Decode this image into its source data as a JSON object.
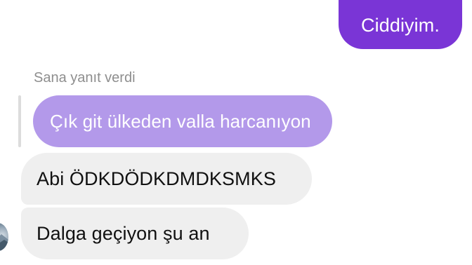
{
  "chat": {
    "sent_message": "Ciddiyim.",
    "reply_label": "Sana yanıt verdi",
    "quoted_message": "Çık git ülkeden valla harcanıyon",
    "received_messages": [
      "Abi ÖDKDÖDKDMDKSMKS",
      "Dalga geçiyon şu an"
    ]
  },
  "colors": {
    "sent_bubble": "#7a35d6",
    "quoted_bubble": "#b399ea",
    "received_bubble": "#efefef",
    "reply_label": "#8e8e8e",
    "background": "#ffffff"
  },
  "icons": {
    "avatar": "user-avatar"
  }
}
